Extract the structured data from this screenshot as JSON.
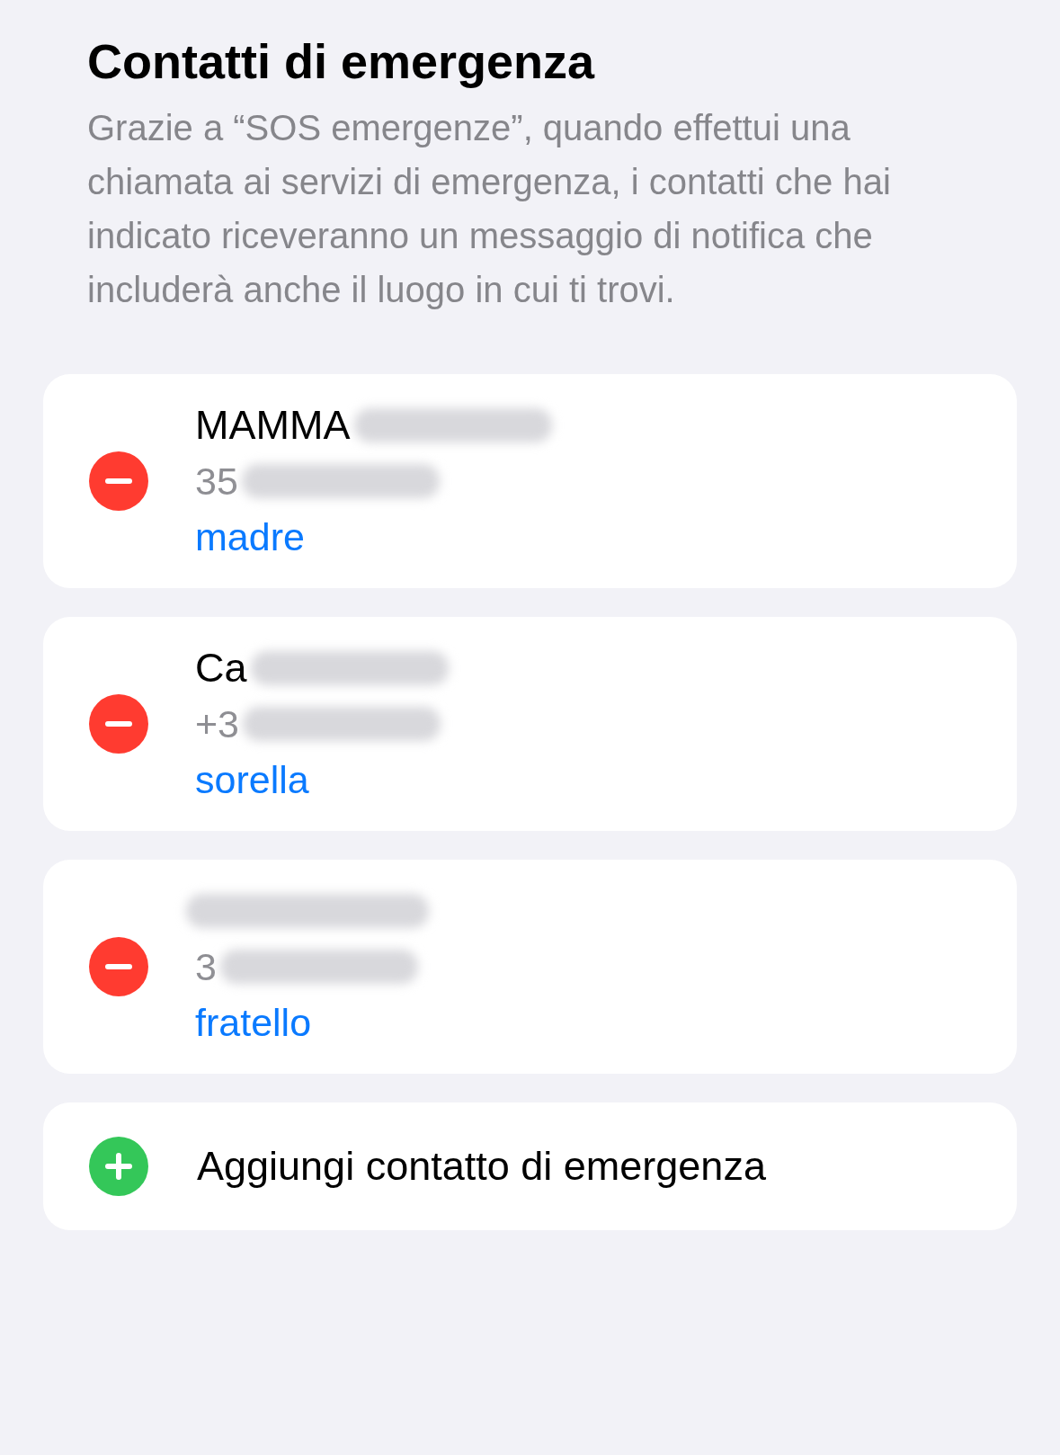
{
  "title": "Contatti di emergenza",
  "description": "Grazie a “SOS emergenze”, quando effettui una chiamata ai servizi di emergenza, i contatti che hai indicato riceveranno un messaggio di notifica che includerà anche il luogo in cui ti trovi.",
  "contacts": [
    {
      "name": "MAMMA",
      "phone": "35",
      "relation": "madre"
    },
    {
      "name": "Ca",
      "phone": "+3",
      "relation": "sorella"
    },
    {
      "phone": "3",
      "relation": "fratello"
    }
  ],
  "add_button": {
    "label": "Aggiungi contatto di emergenza"
  }
}
